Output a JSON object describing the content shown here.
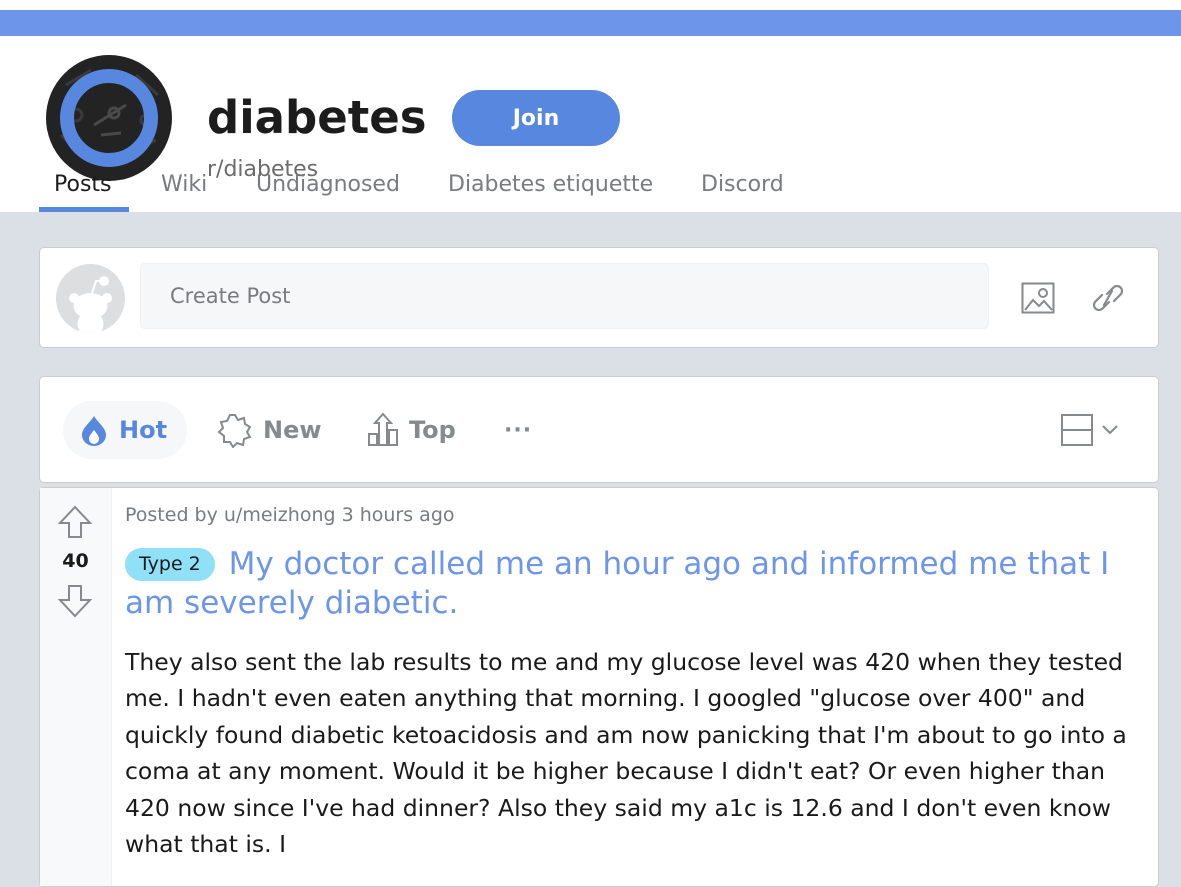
{
  "subreddit": {
    "title": "diabetes",
    "name": "r/diabetes",
    "join_label": "Join",
    "banner_color": "#6d96ea",
    "accent_color": "#5887e0"
  },
  "tabs": [
    {
      "label": "Posts",
      "active": true
    },
    {
      "label": "Wiki"
    },
    {
      "label": "Undiagnosed"
    },
    {
      "label": "Diabetes etiquette"
    },
    {
      "label": "Discord"
    }
  ],
  "create_post": {
    "placeholder": "Create Post",
    "icons": [
      "image-icon",
      "link-icon"
    ]
  },
  "sort": {
    "options": [
      {
        "label": "Hot",
        "icon": "flame-icon",
        "active": true
      },
      {
        "label": "New",
        "icon": "sparkle-badge-icon"
      },
      {
        "label": "Top",
        "icon": "bar-chart-arrow-icon"
      }
    ],
    "more_label": "···",
    "view_icon": "card-view-icon"
  },
  "post": {
    "meta": "Posted by u/meizhong 3 hours ago",
    "votes": "40",
    "flair": "Type 2",
    "flair_color": "#90e0f8",
    "title": "My doctor called me an hour ago and informed me that I am severely diabetic.",
    "body": "They also sent the lab results to me and my glucose level was 420 when they tested me. I hadn't even eaten anything that morning. I googled \"glucose over 400\" and quickly found diabetic ketoacidosis and am now panicking that I'm about to go into a coma at any moment. Would it be higher because I didn't eat? Or even higher than 420 now since I've had dinner? Also they said my a1c is 12.6 and I don't even know what that is. I"
  }
}
